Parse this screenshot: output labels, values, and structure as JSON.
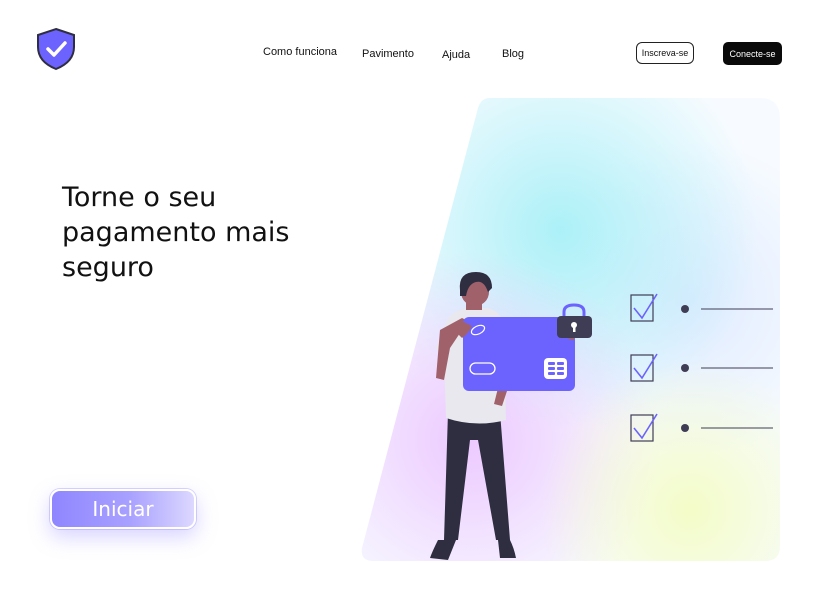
{
  "header": {
    "logo_icon": "shield-check-icon",
    "nav": [
      {
        "label": "Como funciona"
      },
      {
        "label": "Pavimento"
      },
      {
        "label": "Ajuda"
      },
      {
        "label": "Blog"
      }
    ],
    "signup_label": "Inscreva-se",
    "login_label": "Conecte-se"
  },
  "hero": {
    "title_line1": "Torne o seu",
    "title_line2": "pagamento mais",
    "title_line3": "seguro",
    "cta_label": "Iniciar"
  },
  "illustration": {
    "card_icon": "credit-card-icon",
    "lock_icon": "padlock-icon",
    "checklist_count": 3
  },
  "colors": {
    "accent": "#6c63ff",
    "dark": "#2f2e41"
  }
}
